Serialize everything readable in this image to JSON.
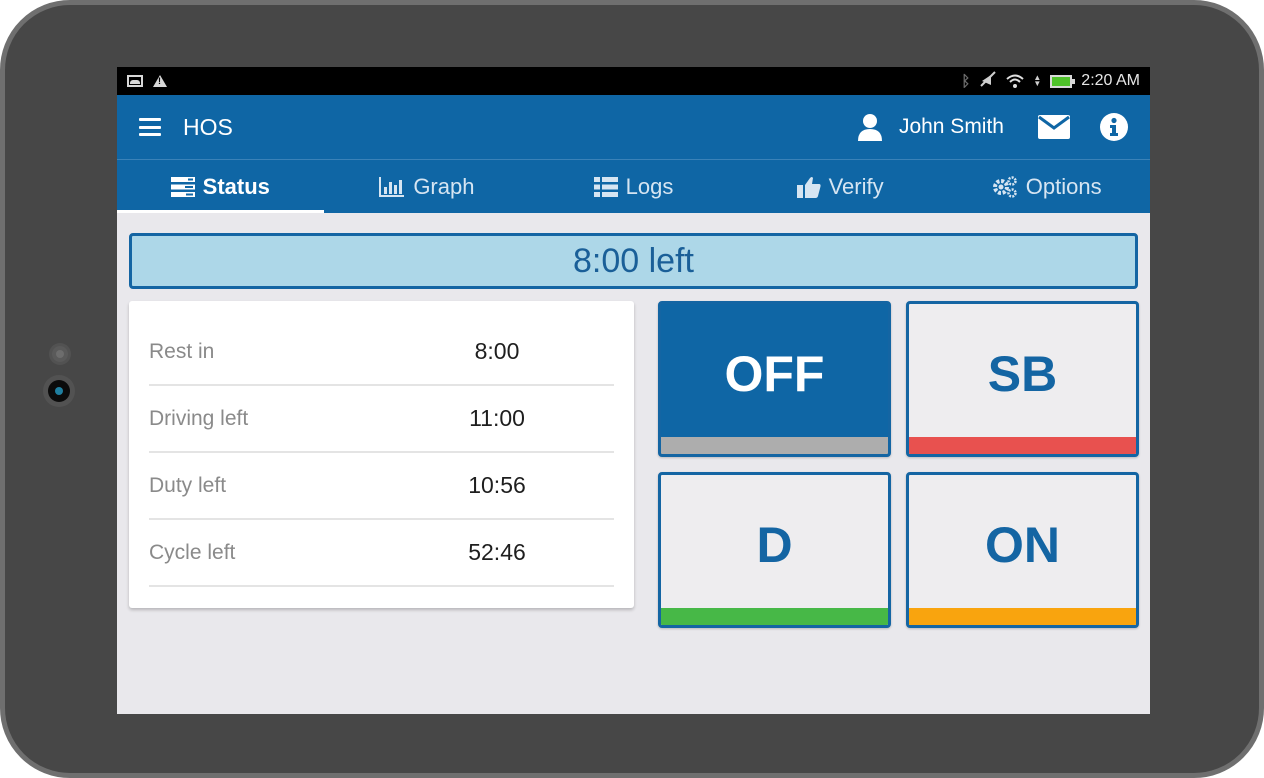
{
  "status_bar": {
    "left_icons": [
      "image-icon",
      "warning-icon"
    ],
    "right_icons": [
      "bluetooth-icon",
      "mute-icon",
      "wifi-icon",
      "data-arrows-icon",
      "battery-charging-icon"
    ],
    "time": "2:20 AM"
  },
  "app_bar": {
    "menu_icon": "hamburger-menu-icon",
    "title": "HOS",
    "user_icon": "user-icon",
    "user_name": "John Smith",
    "mail_icon": "envelope-icon",
    "info_icon": "info-icon"
  },
  "tabs": [
    {
      "label": "Status",
      "icon": "server-list-icon",
      "active": true
    },
    {
      "label": "Graph",
      "icon": "bar-chart-icon",
      "active": false
    },
    {
      "label": "Logs",
      "icon": "list-icon",
      "active": false
    },
    {
      "label": "Verify",
      "icon": "thumbs-up-icon",
      "active": false
    },
    {
      "label": "Options",
      "icon": "gears-icon",
      "active": false
    }
  ],
  "banner": {
    "text": "8:00 left"
  },
  "hours_card": {
    "rows": [
      {
        "label": "Rest in",
        "value": "8:00"
      },
      {
        "label": "Driving left",
        "value": "11:00"
      },
      {
        "label": "Duty left",
        "value": "10:56"
      },
      {
        "label": "Cycle left",
        "value": "52:46"
      }
    ]
  },
  "duty_status": {
    "current": "OFF",
    "buttons": [
      {
        "label": "OFF",
        "color": "#adadad",
        "active": true
      },
      {
        "label": "SB",
        "color": "#e8514f",
        "active": false
      },
      {
        "label": "D",
        "color": "#47b847",
        "active": false
      },
      {
        "label": "ON",
        "color": "#f9a40e",
        "active": false
      }
    ]
  },
  "colors": {
    "primary": "#0f66a5",
    "banner_bg": "#add7e8",
    "background": "#e9e8ec"
  }
}
